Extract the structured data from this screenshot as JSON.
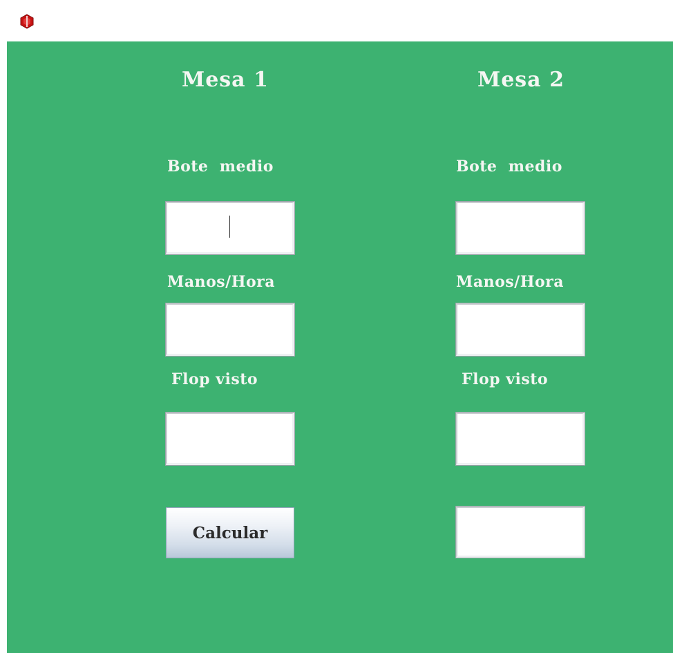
{
  "window": {
    "icon": "poker-chip-icon",
    "icon_color": "#cc1111"
  },
  "colors": {
    "panel_background": "#3db271",
    "text": "#f4f6f2"
  },
  "table1": {
    "title": "Mesa 1",
    "pot_label": "Bote  medio",
    "pot_value": "",
    "hands_label": "Manos/Hora",
    "hands_value": "",
    "flop_label": "Flop visto",
    "flop_value": ""
  },
  "table2": {
    "title": "Mesa 2",
    "pot_label": "Bote  medio",
    "pot_value": "",
    "hands_label": "Manos/Hora",
    "hands_value": "",
    "flop_label": "Flop visto",
    "flop_value": "",
    "result_value": ""
  },
  "actions": {
    "calculate_label": "Calcular"
  }
}
